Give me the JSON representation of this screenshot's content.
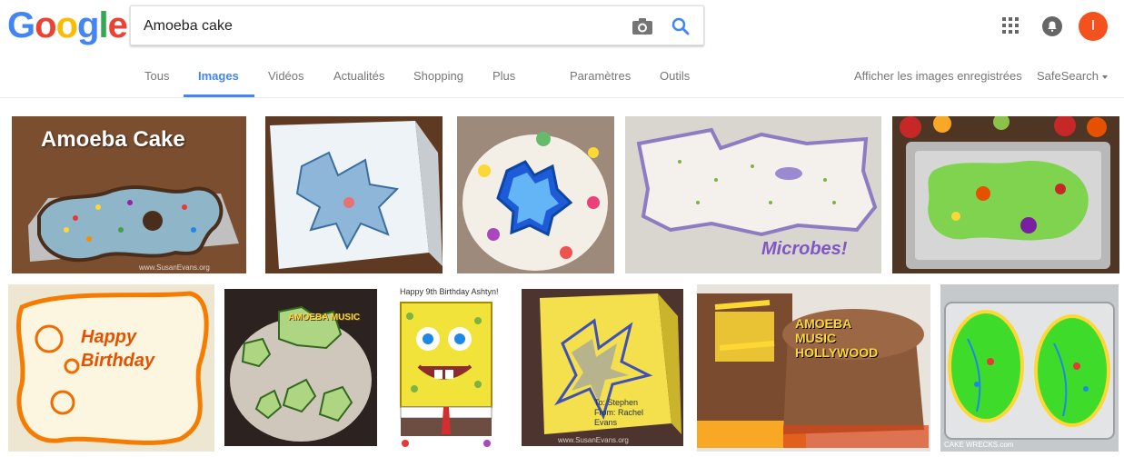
{
  "logo": {
    "letters": [
      "G",
      "o",
      "o",
      "g",
      "l",
      "e"
    ],
    "colors": [
      "#4285f4",
      "#ea4335",
      "#fbbc05",
      "#4285f4",
      "#34a853",
      "#ea4335"
    ]
  },
  "search": {
    "query": "Amoeba cake",
    "camera_icon": "camera-icon",
    "search_icon": "search-icon"
  },
  "header_right": {
    "apps_icon": "apps-grid-icon",
    "notifications_icon": "bell-icon",
    "avatar_initial": "I",
    "avatar_color": "#f4511e"
  },
  "tabs": [
    {
      "label": "Tous",
      "active": false
    },
    {
      "label": "Images",
      "active": true
    },
    {
      "label": "Vidéos",
      "active": false
    },
    {
      "label": "Actualités",
      "active": false
    },
    {
      "label": "Shopping",
      "active": false
    },
    {
      "label": "Plus",
      "active": false
    },
    {
      "label": "Paramètres",
      "active": false
    },
    {
      "label": "Outils",
      "active": false
    }
  ],
  "right_links": {
    "saved_images": "Afficher les images enregistrées",
    "safesearch": "SafeSearch"
  },
  "accent_color": "#4285f4",
  "results": {
    "row1": [
      {
        "name": "amoeba-cake-labeled",
        "overlay_text": "Amoeba Cake",
        "watermark": "www.SusanEvans.org"
      },
      {
        "name": "amoeba-card"
      },
      {
        "name": "amoeba-round-cake"
      },
      {
        "name": "microbes-cupcake-cake",
        "overlay_text": "Microbes!"
      },
      {
        "name": "green-amoeba-foil-cake"
      }
    ],
    "row2": [
      {
        "name": "happy-birthday-amoeba-cake",
        "overlay_text": "Happy Birthday"
      },
      {
        "name": "amoeba-music-cupcakes",
        "overlay_text": "AMOEBA MUSIC"
      },
      {
        "name": "spongebob-birthday-cake",
        "overlay_text": "Happy 9th Birthday Ashtyn!"
      },
      {
        "name": "amoeba-yellow-box-cake",
        "overlay_text": "To: Stephen From: Rachel Evans",
        "watermark": "www.SusanEvans.org"
      },
      {
        "name": "amoeba-music-hollywood-cake",
        "overlay_text": "AMOEBA MUSIC HOLLYWOOD"
      },
      {
        "name": "green-paramecium-cakes",
        "watermark": "CAKE WRECKS.com"
      }
    ]
  }
}
